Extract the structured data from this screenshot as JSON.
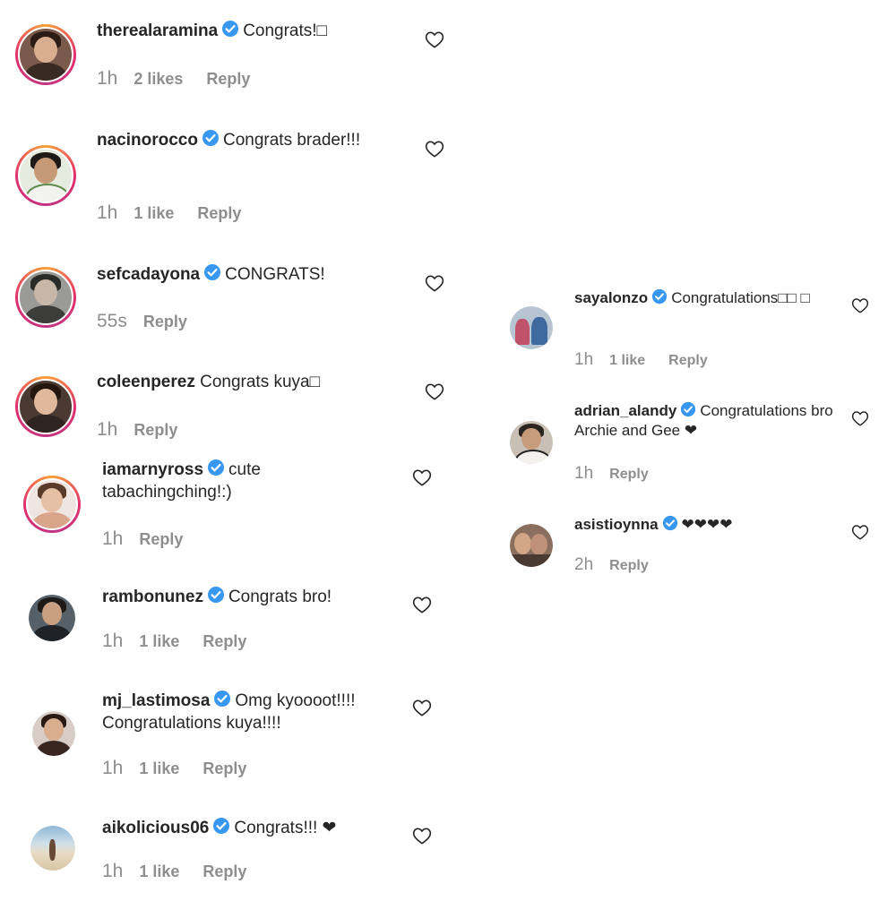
{
  "comments_left": [
    {
      "username": "therealaramina",
      "text": "Congrats!□",
      "time": "1h",
      "likes": "2 likes",
      "reply": "Reply",
      "verified": true
    },
    {
      "username": "nacinorocco",
      "text": "Congrats brader!!!",
      "time": "1h",
      "likes": "1 like",
      "reply": "Reply",
      "verified": true
    },
    {
      "username": "sefcadayona",
      "text": "CONGRATS!",
      "time": "55s",
      "likes": "",
      "reply": "Reply",
      "verified": true
    },
    {
      "username": "coleenperez",
      "text": "Congrats kuya□",
      "time": "1h",
      "likes": "",
      "reply": "Reply",
      "verified": false
    },
    {
      "username": "iamarnyross",
      "text": "cute tabachingching!:)",
      "time": "1h",
      "likes": "",
      "reply": "Reply",
      "verified": true
    },
    {
      "username": "rambonunez",
      "text": "Congrats bro!",
      "time": "1h",
      "likes": "1 like",
      "reply": "Reply",
      "verified": true
    },
    {
      "username": "mj_lastimosa",
      "text": "Omg kyoooot!!!! Congratulations kuya!!!!",
      "time": "1h",
      "likes": "1 like",
      "reply": "Reply",
      "verified": true
    },
    {
      "username": "aikolicious06",
      "text": "Congrats!!! ❤",
      "time": "1h",
      "likes": "1 like",
      "reply": "Reply",
      "verified": true
    }
  ],
  "comments_right": [
    {
      "username": "sayalonzo",
      "text": "Congratulations□□ □",
      "time": "1h",
      "likes": "1 like",
      "reply": "Reply",
      "verified": true
    },
    {
      "username": "adrian_alandy",
      "text": "Congratulations bro Archie and Gee ❤",
      "time": "1h",
      "likes": "",
      "reply": "Reply",
      "verified": true
    },
    {
      "username": "asistioynna",
      "text": "❤❤❤❤",
      "time": "2h",
      "likes": "",
      "reply": "Reply",
      "verified": true
    }
  ],
  "icons": {
    "verified": "verified-badge-icon",
    "like": "heart-outline-icon"
  },
  "colors": {
    "verified_blue": "#3897f0",
    "meta_gray": "#8e8e8e",
    "text": "#262626"
  }
}
